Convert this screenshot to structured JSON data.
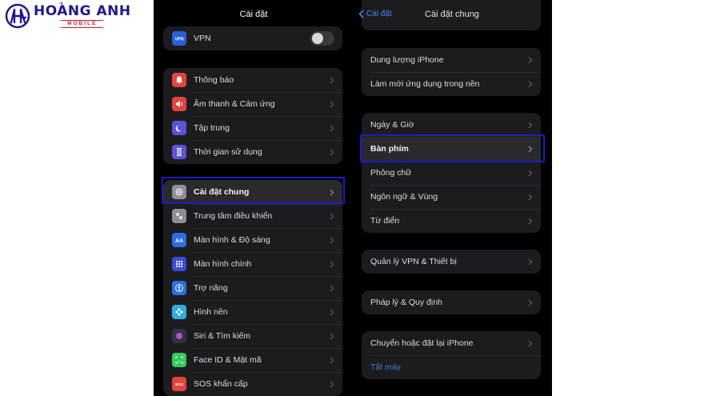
{
  "logo": {
    "main": "HOÀNG ANH",
    "sub": "MOBILE"
  },
  "left_screen": {
    "title": "Cài đặt",
    "vpn": {
      "label": "VPN",
      "icon": "vpn-icon",
      "toggle_on": false,
      "color": "#2a5fd6"
    },
    "group1": [
      {
        "label": "Thông báo",
        "icon": "bell-icon",
        "color": "#e0443d"
      },
      {
        "label": "Âm thanh & Cảm ứng",
        "icon": "speaker-icon",
        "color": "#e0443d"
      },
      {
        "label": "Tập trung",
        "icon": "moon-icon",
        "color": "#5c54d6"
      },
      {
        "label": "Thời gian sử dụng",
        "icon": "hourglass-icon",
        "color": "#5c54d6"
      }
    ],
    "group2": [
      {
        "label": "Cài đặt chung",
        "icon": "gear-icon",
        "color": "#8e8e93",
        "selected": true
      },
      {
        "label": "Trung tâm điều khiển",
        "icon": "switches-icon",
        "color": "#8e8e93"
      },
      {
        "label": "Màn hình & Độ sáng",
        "icon": "text-size-icon",
        "color": "#2a6ee0"
      },
      {
        "label": "Màn hình chính",
        "icon": "grid-icon",
        "color": "#3c4bd6"
      },
      {
        "label": "Trợ năng",
        "icon": "accessibility-icon",
        "color": "#2a6ee0"
      },
      {
        "label": "Hình nền",
        "icon": "flower-icon",
        "color": "#34aadc"
      },
      {
        "label": "Siri & Tìm kiếm",
        "icon": "siri-icon",
        "color": "#333344"
      },
      {
        "label": "Face ID & Mật mã",
        "icon": "face-id-icon",
        "color": "#34c759"
      },
      {
        "label": "SOS khẩn cấp",
        "icon": "sos-icon",
        "color": "#e0443d"
      }
    ]
  },
  "right_screen": {
    "back_label": "Cài đặt",
    "title": "Cài đặt chung",
    "group1": [
      {
        "label": "Dung lượng iPhone"
      },
      {
        "label": "Làm mới ứng dụng trong nền"
      }
    ],
    "group2": [
      {
        "label": "Ngày & Giờ"
      },
      {
        "label": "Bàn phím",
        "selected": true
      },
      {
        "label": "Phông chữ"
      },
      {
        "label": "Ngôn ngữ & Vùng"
      },
      {
        "label": "Từ điển"
      }
    ],
    "group3": [
      {
        "label": "Quản lý VPN & Thiết bị"
      }
    ],
    "group4": [
      {
        "label": "Pháp lý & Quy định"
      }
    ],
    "group5": [
      {
        "label": "Chuyển hoặc đặt lại iPhone"
      },
      {
        "label": "Tắt máy",
        "link": true
      }
    ]
  },
  "colors": {
    "highlight": "#1a1cc8",
    "accent": "#3f8cf5"
  }
}
